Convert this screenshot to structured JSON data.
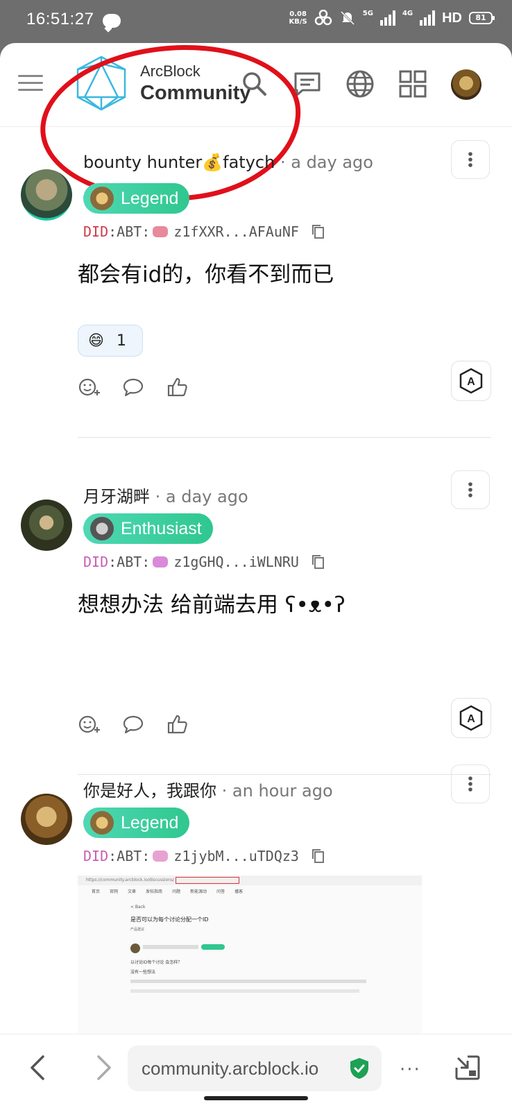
{
  "status_bar": {
    "time": "16:51:27",
    "net_speed_value": "0.08",
    "net_speed_unit": "KB/S",
    "sig1": "5G",
    "sig2": "4G",
    "hd": "HD",
    "battery": "81"
  },
  "header": {
    "logo_line1": "ArcBlock",
    "logo_line2": "Community",
    "icons": [
      "menu-icon",
      "search-icon",
      "chat-icon",
      "globe-icon",
      "apps-icon",
      "avatar"
    ]
  },
  "posts": [
    {
      "author": "bounty hunter💰fatych",
      "time": "· a day ago",
      "badge": "Legend",
      "did_prefix": "DID",
      "did_sep": ":ABT:",
      "did_value": "z1fXXR...AFAuNF",
      "content": "都会有id的，你看不到而已",
      "reaction_emoji": "😄",
      "reaction_count": "1",
      "badge_icon_color": "#8a6a3a"
    },
    {
      "author": "月牙湖畔",
      "time": "· a day ago",
      "badge": "Enthusiast",
      "did_prefix": "DID",
      "did_sep": ":ABT:",
      "did_value": "z1gGHQ...iWLNRU",
      "content": "想想办法 给前端去用 ʕ•ᴥ•ʔ",
      "badge_icon_color": "#555555"
    },
    {
      "author": "你是好人，我跟你",
      "time": "· an hour ago",
      "badge": "Legend",
      "did_prefix": "DID",
      "did_sep": ":ABT:",
      "did_value": "z1jybM...uTDQz3",
      "badge_icon_color": "#8a6a3a"
    }
  ],
  "screenshot_preview": {
    "url": "https://community.arcblock.io/discussions/",
    "nav_items": [
      "首页",
      "官网",
      "文章",
      "发帖指南",
      "问题",
      "新能源动",
      "问答",
      "播客"
    ],
    "back": "< Back",
    "title": "是否可以为每个讨论分配一个ID",
    "tag": "产品建议",
    "line1": "以讨论ID每个讨论 会怎样？",
    "line2": "没有一些想法"
  },
  "browser": {
    "url": "community.arcblock.io",
    "more": "···"
  },
  "colors": {
    "accent_green": "#2fc78f",
    "red_circle": "#e0101a",
    "did_red": "#d23a4a"
  }
}
